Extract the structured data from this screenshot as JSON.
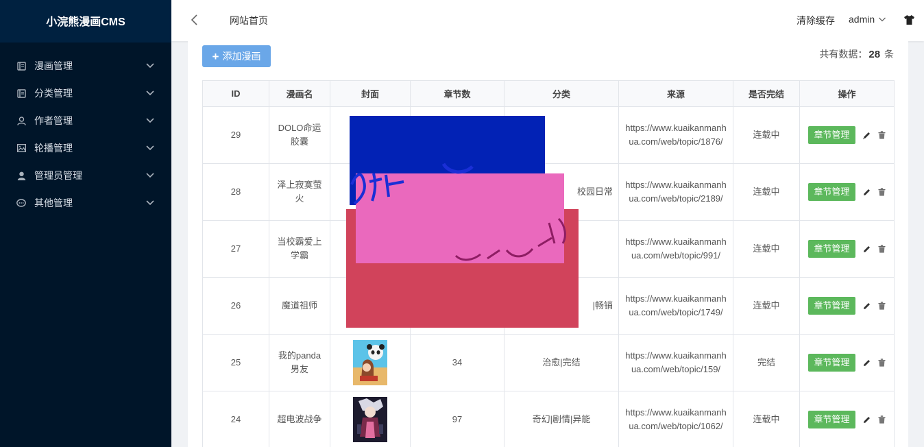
{
  "brand": {
    "title": "小浣熊漫画CMS"
  },
  "sidebar": {
    "items": [
      {
        "label": "漫画管理",
        "icon": "book-icon"
      },
      {
        "label": "分类管理",
        "icon": "book-icon"
      },
      {
        "label": "作者管理",
        "icon": "user-outline-icon"
      },
      {
        "label": "轮播管理",
        "icon": "image-icon"
      },
      {
        "label": "管理员管理",
        "icon": "user-solid-icon"
      },
      {
        "label": "其他管理",
        "icon": "chat-bubble-icon"
      }
    ]
  },
  "header": {
    "breadcrumb": "网站首页",
    "clear_cache": "清除缓存",
    "user": "admin"
  },
  "toolbar": {
    "add_label": "添加漫画",
    "total_prefix": "共有数据：",
    "total_count": "28",
    "total_suffix": "条"
  },
  "table": {
    "columns": [
      "ID",
      "漫画名",
      "封面",
      "章节数",
      "分类",
      "来源",
      "是否完结",
      "操作"
    ],
    "action_label": "章节管理",
    "rows": [
      {
        "id": "29",
        "name": "DOLO命运胶囊",
        "chapters": "",
        "category": "",
        "source": "https://www.kuaikanmanhua.com/web/topic/1876/",
        "status": "连载中"
      },
      {
        "id": "28",
        "name": "泽上寂寞萤火",
        "chapters": "",
        "category": "校园日常",
        "source": "https://www.kuaikanmanhua.com/web/topic/2189/",
        "status": "连载中"
      },
      {
        "id": "27",
        "name": "当校霸爱上学霸",
        "chapters": "",
        "category": "",
        "source": "https://www.kuaikanmanhua.com/web/topic/991/",
        "status": "连载中"
      },
      {
        "id": "26",
        "name": "魔道祖师",
        "chapters": "",
        "category": "|畅销",
        "source": "https://www.kuaikanmanhua.com/web/topic/1749/",
        "status": "连载中"
      },
      {
        "id": "25",
        "name": "我的panda男友",
        "chapters": "34",
        "category": "治愈|完结",
        "source": "https://www.kuaikanmanhua.com/web/topic/159/",
        "status": "完结"
      },
      {
        "id": "24",
        "name": "超电波战争",
        "chapters": "97",
        "category": "奇幻|剧情|异能",
        "source": "https://www.kuaikanmanhua.com/web/topic/1062/",
        "status": "连载中"
      }
    ]
  },
  "colors": {
    "sidebar_bg": "#001529",
    "primary_button": "#6aa7e8",
    "success_button": "#5cb85c",
    "overlay_blue": "#0222b5",
    "overlay_red": "#d1435b",
    "overlay_pink": "#ea69bd"
  }
}
